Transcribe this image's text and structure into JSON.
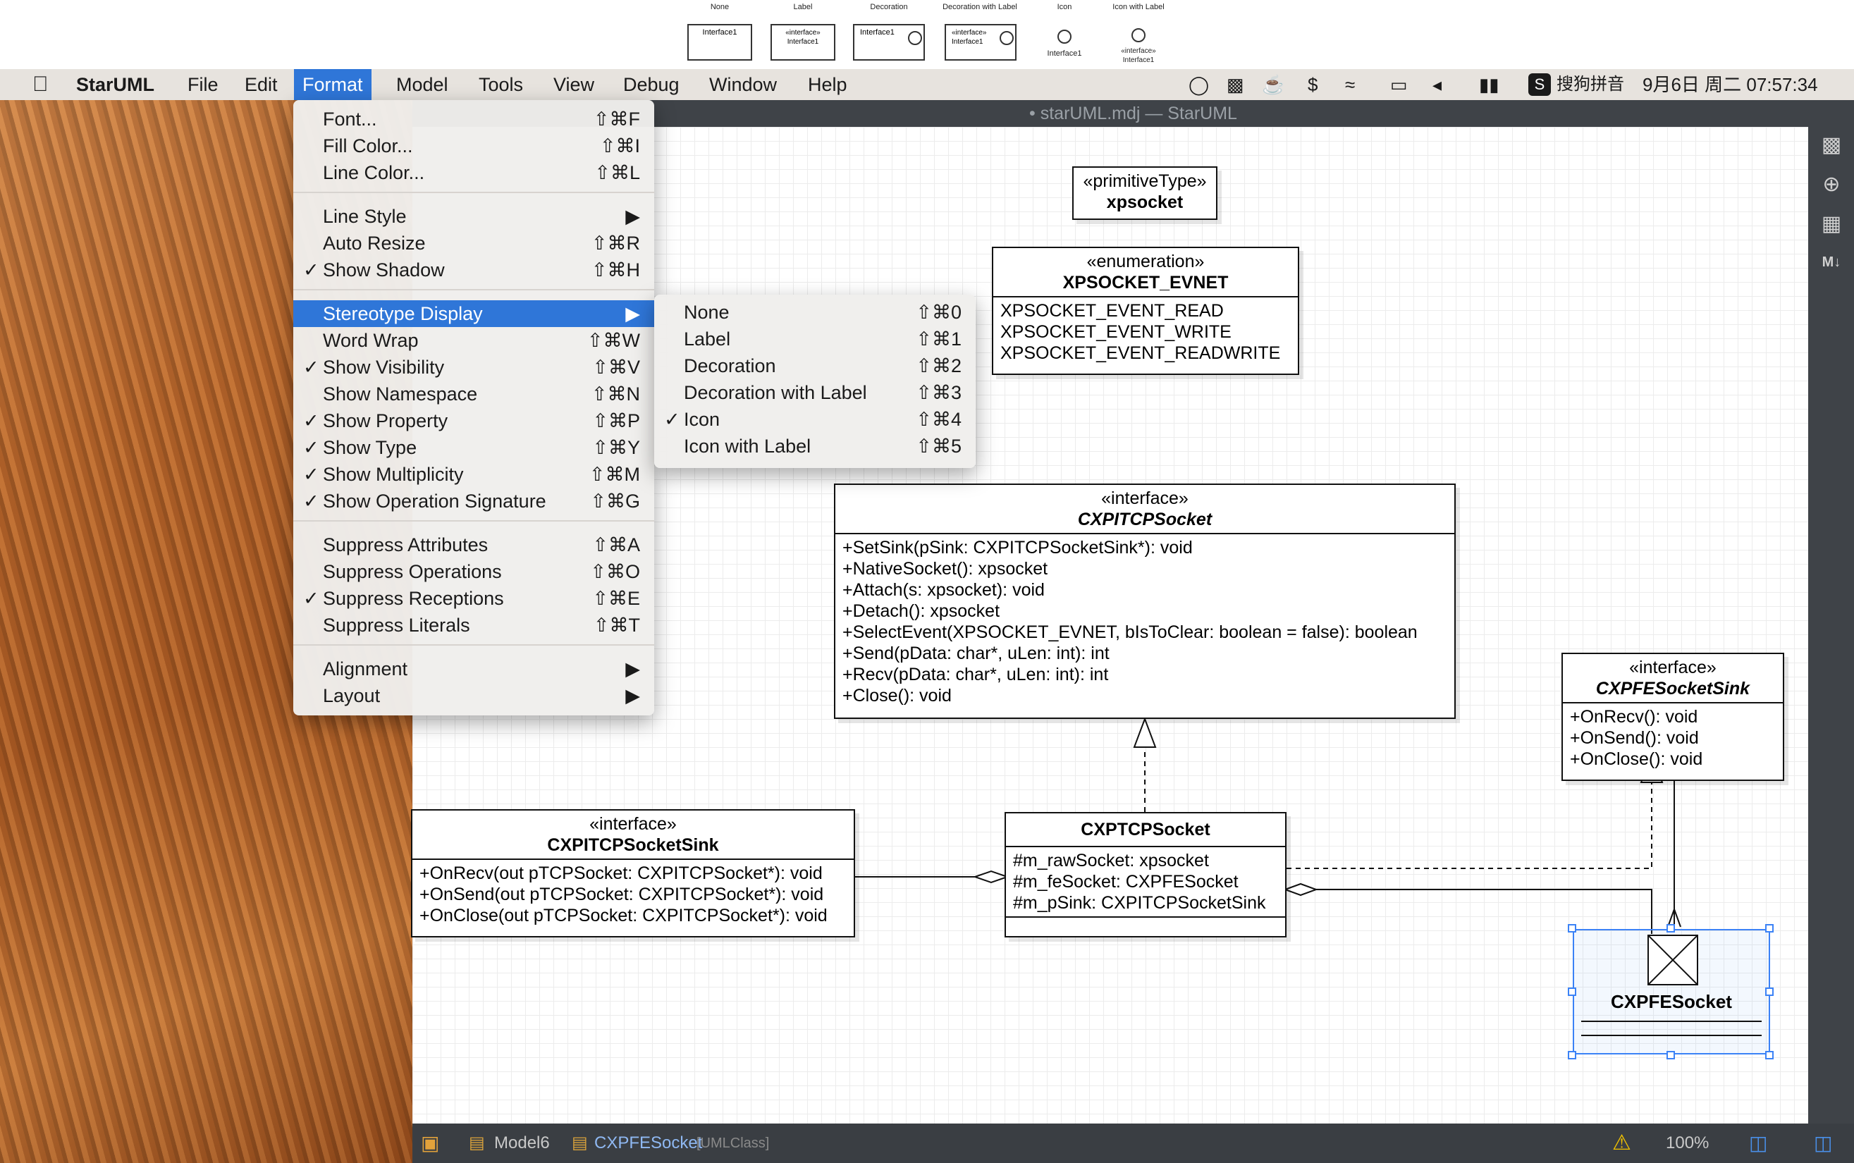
{
  "legend": {
    "items": [
      {
        "label": "None",
        "box": "Interface1"
      },
      {
        "label": "Label",
        "box_stereo": "«interface»",
        "box": "Interface1"
      },
      {
        "label": "Decoration",
        "box": "Interface1"
      },
      {
        "label": "Decoration with Label",
        "box_stereo": "«interface»",
        "box": "Interface1"
      },
      {
        "label": "Icon",
        "box": "Interface1"
      },
      {
        "label": "Icon with Label",
        "box_stereo": "«interface»",
        "box": "Interface1"
      }
    ]
  },
  "menubar": {
    "apple": "",
    "app_name": "StarUML",
    "items": [
      "File",
      "Edit",
      "Format",
      "Model",
      "Tools",
      "View",
      "Debug",
      "Window",
      "Help"
    ],
    "active": "Format",
    "input_method": "搜狗拼音",
    "datetime": "9月6日 周二  07:57:34"
  },
  "window": {
    "title": "• starUML.mdj — StarUML"
  },
  "format_menu": {
    "items": [
      {
        "label": "Font...",
        "shortcut": "⇧⌘F",
        "checked": false
      },
      {
        "label": "Fill Color...",
        "shortcut": "⇧⌘I",
        "checked": false
      },
      {
        "label": "Line Color...",
        "shortcut": "⇧⌘L",
        "checked": false
      },
      {
        "label": "Line Style",
        "submenu": true,
        "checked": false
      },
      {
        "label": "Auto Resize",
        "shortcut": "⇧⌘R",
        "checked": false
      },
      {
        "label": "Show Shadow",
        "shortcut": "⇧⌘H",
        "checked": true
      },
      {
        "label": "Stereotype Display",
        "submenu": true,
        "highlighted": true
      },
      {
        "label": "Word Wrap",
        "shortcut": "⇧⌘W",
        "checked": false
      },
      {
        "label": "Show Visibility",
        "shortcut": "⇧⌘V",
        "checked": true
      },
      {
        "label": "Show Namespace",
        "shortcut": "⇧⌘N",
        "checked": false
      },
      {
        "label": "Show Property",
        "shortcut": "⇧⌘P",
        "checked": true
      },
      {
        "label": "Show Type",
        "shortcut": "⇧⌘Y",
        "checked": true
      },
      {
        "label": "Show Multiplicity",
        "shortcut": "⇧⌘M",
        "checked": true
      },
      {
        "label": "Show Operation Signature",
        "shortcut": "⇧⌘G",
        "checked": true
      },
      {
        "label": "Suppress Attributes",
        "shortcut": "⇧⌘A",
        "checked": false
      },
      {
        "label": "Suppress Operations",
        "shortcut": "⇧⌘O",
        "checked": false
      },
      {
        "label": "Suppress Receptions",
        "shortcut": "⇧⌘E",
        "checked": true
      },
      {
        "label": "Suppress Literals",
        "shortcut": "⇧⌘T",
        "checked": false
      },
      {
        "label": "Alignment",
        "submenu": true
      },
      {
        "label": "Layout",
        "submenu": true
      }
    ]
  },
  "stereotype_menu": {
    "items": [
      {
        "label": "None",
        "shortcut": "⇧⌘0",
        "checked": false
      },
      {
        "label": "Label",
        "shortcut": "⇧⌘1",
        "checked": false
      },
      {
        "label": "Decoration",
        "shortcut": "⇧⌘2",
        "checked": false
      },
      {
        "label": "Decoration with Label",
        "shortcut": "⇧⌘3",
        "checked": false
      },
      {
        "label": "Icon",
        "shortcut": "⇧⌘4",
        "checked": true
      },
      {
        "label": "Icon with Label",
        "shortcut": "⇧⌘5",
        "checked": false
      }
    ]
  },
  "diagram": {
    "primitive": {
      "stereo": "«primitiveType»",
      "name": "xpsocket"
    },
    "enumeration": {
      "stereo": "«enumeration»",
      "name": "XPSOCKET_EVNET",
      "literals": [
        "XPSOCKET_EVENT_READ",
        "XPSOCKET_EVENT_WRITE",
        "XPSOCKET_EVENT_READWRITE"
      ]
    },
    "cxpitcpsocket": {
      "stereo": "«interface»",
      "name": "CXPITCPSocket",
      "operations": [
        "+SetSink(pSink: CXPITCPSocketSink*): void",
        "+NativeSocket(): xpsocket",
        "+Attach(s: xpsocket): void",
        "+Detach(): xpsocket",
        "+SelectEvent(XPSOCKET_EVNET, bIsToClear: boolean = false): boolean",
        "+Send(pData: char*, uLen: int): int",
        "+Recv(pData: char*, uLen: int): int",
        "+Close(): void"
      ]
    },
    "cxpfesocketsink": {
      "stereo": "«interface»",
      "name": "CXPFESocketSink",
      "operations": [
        "+OnRecv(): void",
        "+OnSend(): void",
        "+OnClose(): void"
      ]
    },
    "cxpitcpsocketsink": {
      "stereo": "«interface»",
      "name": "CXPITCPSocketSink",
      "operations": [
        "+OnRecv(out pTCPSocket: CXPITCPSocket*): void",
        "+OnSend(out pTCPSocket: CXPITCPSocket*): void",
        "+OnClose(out pTCPSocket: CXPITCPSocket*): void"
      ]
    },
    "cxptcpsocket": {
      "name": "CXPTCPSocket",
      "attributes": [
        "#m_rawSocket: xpsocket",
        "#m_feSocket: CXPFESocket",
        "#m_pSink: CXPITCPSocketSink"
      ]
    },
    "cxpfesocket": {
      "name": "CXPFESocket"
    }
  },
  "statusbar": {
    "model": "Model6",
    "selection": "CXPFESocket",
    "selection_type": "[UMLClass]",
    "zoom": "100%"
  },
  "colors": {
    "accent": "#2f76d8",
    "selection": "#3b82f6"
  }
}
